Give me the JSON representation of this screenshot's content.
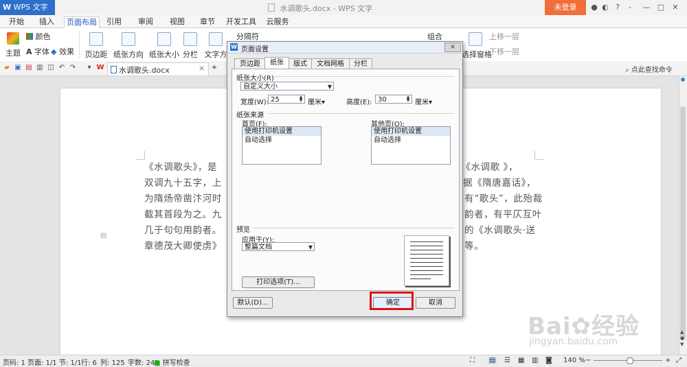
{
  "titlebar": {
    "app_name": "WPS 文字",
    "app_caret": "▾",
    "doc_title": "水调歌头.docx - WPS 文字",
    "login_label": "未登录",
    "icons": [
      "skin-icon",
      "share-icon",
      "help-icon",
      "minimize-icon",
      "restore-icon",
      "close-icon"
    ]
  },
  "ribbon_tabs": [
    "开始",
    "插入",
    "页面布局",
    "引用",
    "审阅",
    "视图",
    "章节",
    "开发工具",
    "云服务"
  ],
  "ribbon_active_tab": "页面布局",
  "ribbon": {
    "theme": "主题",
    "colors": "颜色",
    "fonts": "字体",
    "effects": "效果",
    "margins": "页边距",
    "orientation": "纸张方向",
    "size": "纸张大小",
    "columns": "分栏",
    "text_direction": "文字方",
    "separator": "分隔符",
    "group": "组合",
    "selection_pane": "选择窗格",
    "bring_forward": "上移一层",
    "send_backward": "下移一层"
  },
  "quick_access": {
    "doc_tab_label": "水调歌头.docx",
    "find_command": "点此查找命令",
    "new_tab_symbol": "+",
    "close_symbol": "×"
  },
  "document": {
    "lines": [
      "《水调歌头》，是",
      "双调九十五字，上",
      "为隋炀帝凿汴河时",
      "截其首段为之。九",
      "几于句句用韵者。",
      "章德茂大卿使虏》"
    ],
    "lines_right": [
      "，《水调歌 》，",
      "据《隋唐嘉话》，",
      "有“歌头”，此殆裁",
      "韵者，有平仄互叶",
      "的《水调歌头·送",
      "等。"
    ]
  },
  "dialog": {
    "title": "页面设置",
    "close_symbol": "×",
    "tabs": [
      "页边距",
      "纸张",
      "版式",
      "文档网格",
      "分栏"
    ],
    "active_tab": "纸张",
    "paper_size_section": "纸张大小(R)",
    "paper_size_value": "自定义大小",
    "width_label": "宽度(W):",
    "width_value": "25",
    "width_unit": "厘米",
    "height_label": "高度(E):",
    "height_value": "30",
    "height_unit": "厘米",
    "paper_source_section": "纸张来源",
    "first_page_label": "首页(F):",
    "first_page_options": [
      "使用打印机设置",
      "自动选择"
    ],
    "other_pages_label": "其他页(O):",
    "other_pages_options": [
      "使用打印机设置",
      "自动选择"
    ],
    "preview_section": "预览",
    "apply_to_label": "应用于(Y):",
    "apply_to_value": "整篇文档",
    "print_options_button": "打印选项(T)...",
    "default_button": "默认(D)...",
    "ok_button": "确定",
    "cancel_button": "取消"
  },
  "statusbar": {
    "page": "页码: 1",
    "pages": "页面: 1/1",
    "section": "节: 1/1",
    "row": "行: 6",
    "col": "列: 125",
    "words": "字数: 241",
    "spellcheck": "拼写检查",
    "zoom": "140 %",
    "zoom_minus": "−",
    "zoom_plus": "+"
  },
  "watermark": {
    "brand": "Bai",
    "brand_cn": "经验",
    "url": "jingyan.baidu.com"
  },
  "colors": {
    "accent": "#2d6fcb",
    "login": "#f16d39",
    "highlight": "#e01010"
  }
}
